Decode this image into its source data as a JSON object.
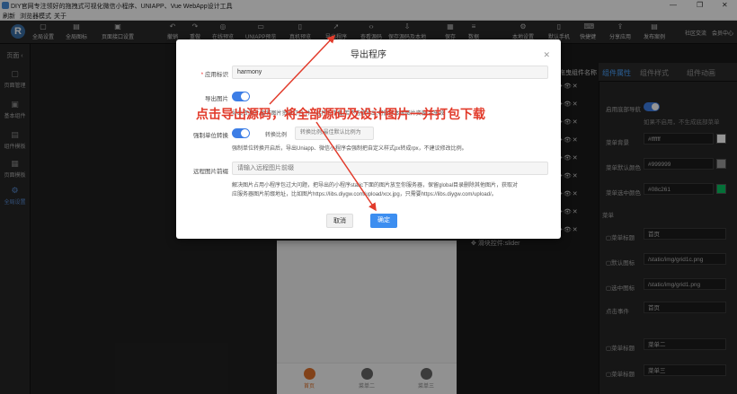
{
  "window": {
    "title": "DIY官网专注领好的拖拽式可视化微信小程序、UNIAPP、Vue WebApp设计工具",
    "controls": [
      "—",
      "❐",
      "✕"
    ]
  },
  "menubar": [
    "刷新",
    "浏览器模式",
    "关于"
  ],
  "toolbar": {
    "left": [
      "全局设置",
      "全局图标",
      "页面接口设置"
    ],
    "middle": [
      "撤销",
      "重做",
      "在线预览",
      "UNIAPP预览",
      "真机预览",
      "导出程序",
      "查看源码",
      "保存源码及本地",
      "保存",
      "数据"
    ],
    "right": [
      "本地设置",
      "默认手机",
      "快捷键",
      "分享应用",
      "发布案例"
    ],
    "links": [
      "社区交流",
      "会员中心"
    ]
  },
  "leftbar": {
    "header": "页面",
    "items": [
      "页面管理",
      "基本组件",
      "组件模板",
      "页面模板",
      "全局设置"
    ],
    "active_index": 4
  },
  "component_list": {
    "header": "拖曳组件名称"
  },
  "canvas": {
    "slider_label": "滑块控件:slider",
    "tabbar": [
      "首页",
      "菜单二",
      "菜单三"
    ]
  },
  "right_panel": {
    "tabs": [
      "组件属性",
      "组件样式",
      "组件动画"
    ],
    "active_tab": 0,
    "toggle_label": "启用底部导航",
    "toggle_help": "如果不启用，不生成底部菜单",
    "rows": [
      {
        "label": "菜单背景",
        "value": "#ffffff",
        "color": "#ffffff"
      },
      {
        "label": "菜单默认颜色",
        "value": "#999999",
        "color": "#999999"
      },
      {
        "label": "菜单选中颜色",
        "value": "#08c261",
        "color": "#08c261"
      }
    ],
    "menu_section": "菜单",
    "menu_items": [
      {
        "label": "菜单标题",
        "value": "首页"
      },
      {
        "label": "默认图标",
        "value": "/static/img/grid1c.png"
      },
      {
        "label": "选中图标",
        "value": "/static/img/grid1.png"
      },
      {
        "label": "点击事件",
        "value": "首页"
      },
      {
        "label": "菜单标题",
        "value": "菜单二"
      },
      {
        "label": "菜单标题",
        "value": "菜单三"
      }
    ]
  },
  "modal": {
    "title": "导出程序",
    "app_id_label": "应用标识",
    "app_id_value": "harmony",
    "export_img_label": "导出图片",
    "export_img_help": "导出资源时,会将图片资源打包,并一起打包下载,若不选择导出,将删除本地图片资源,会失效",
    "force_label": "强制单位转换",
    "ratio_label": "转换比例",
    "ratio_placeholder": "转换比例,最佳默认比例为",
    "force_help": "强制单位转换开启后，导出Uniapp、微信小程序会强制把自定义样式px转成rpx，不建议修改比例。",
    "remote_label": "远程图片前缀",
    "remote_placeholder": "请输入远程图片前缀",
    "remote_help_1": "解决图片占用小程序包过大问题，把导出的小程序static下面的图片放至你服务器，保留global目录删除其他图片，获取对",
    "remote_help_2": "应服务器图片前缀地址，比如图片https://libs.diygw.com/upload/xcx.jpg，只需要https://libs.diygw.com/upload/。",
    "cancel": "取消",
    "ok": "确定"
  },
  "annotation": "点击导出源码，将全部源码及设计图片一并打包下载"
}
